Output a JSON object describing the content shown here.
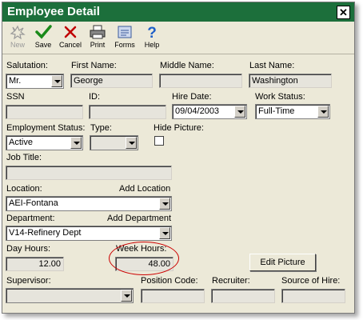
{
  "window": {
    "title": "Employee Detail",
    "close_icon": "close-icon"
  },
  "toolbar": {
    "new": "New",
    "save": "Save",
    "cancel": "Cancel",
    "print": "Print",
    "forms": "Forms",
    "help": "Help"
  },
  "form": {
    "salutation": {
      "label": "Salutation:",
      "value": "Mr."
    },
    "first_name": {
      "label": "First Name:",
      "value": "George"
    },
    "middle_name": {
      "label": "Middle Name:",
      "value": ""
    },
    "last_name": {
      "label": "Last Name:",
      "value": "Washington"
    },
    "ssn": {
      "label": "SSN",
      "value": ""
    },
    "id": {
      "label": "ID:",
      "value": ""
    },
    "hire_date": {
      "label": "Hire Date:",
      "value": "09/04/2003"
    },
    "work_status": {
      "label": "Work Status:",
      "value": "Full-Time"
    },
    "employment_status": {
      "label": "Employment Status:",
      "value": "Active"
    },
    "type": {
      "label": "Type:",
      "value": ""
    },
    "hide_picture": {
      "label": "Hide Picture:",
      "checked": false
    },
    "job_title": {
      "label": "Job Title:",
      "value": ""
    },
    "location": {
      "label": "Location:",
      "add_label": "Add Location",
      "value": "AEI-Fontana"
    },
    "department": {
      "label": "Department:",
      "add_label": "Add Department",
      "value": "V14-Refinery Dept"
    },
    "day_hours": {
      "label": "Day Hours:",
      "value": "12.00"
    },
    "week_hours": {
      "label": "Week Hours:",
      "value": "48.00"
    },
    "edit_picture": "Edit Picture",
    "supervisor": {
      "label": "Supervisor:",
      "value": ""
    },
    "position_code": {
      "label": "Position Code:",
      "value": ""
    },
    "recruiter": {
      "label": "Recruiter:",
      "value": ""
    },
    "source_of_hire": {
      "label": "Source of Hire:",
      "value": ""
    }
  },
  "colors": {
    "titlebar": "#1c6f3b",
    "highlight_oval": "#cc0000",
    "window_bg": "#ece9d8"
  }
}
